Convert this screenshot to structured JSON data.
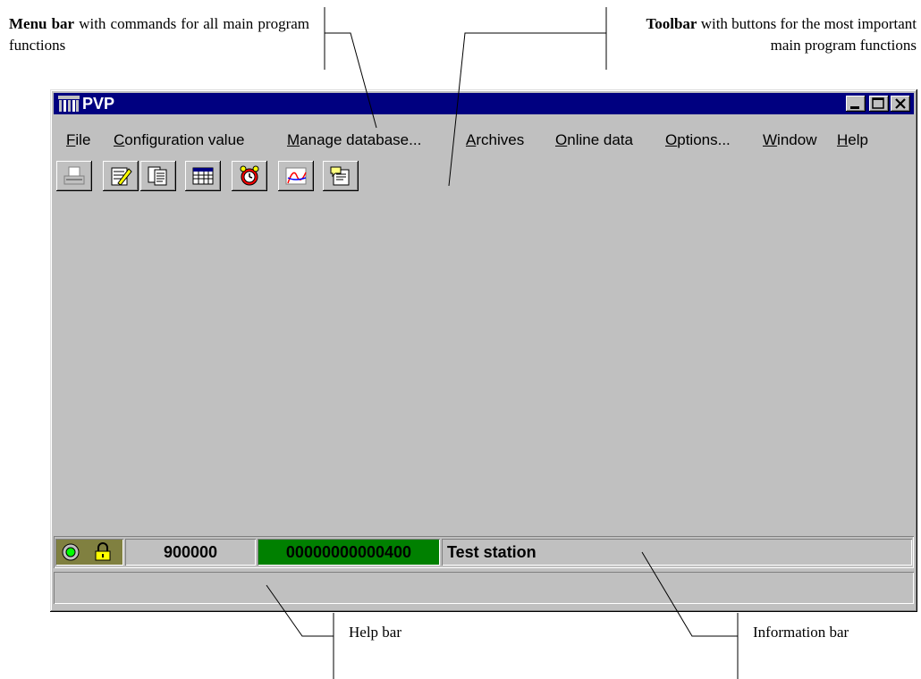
{
  "callouts": {
    "menu_bold": "Menu bar",
    "menu_rest": " with commands for all main program functions",
    "toolbar_bold": "Toolbar",
    "toolbar_rest": " with buttons for the most important main program functions",
    "help": "Help bar",
    "info": "Information bar"
  },
  "window": {
    "title": "PVP",
    "menu": [
      {
        "underline": "F",
        "rest": "ile"
      },
      {
        "underline": "C",
        "rest": "onfiguration value"
      },
      {
        "underline": "M",
        "rest": "anage database..."
      },
      {
        "underline": "A",
        "rest": "rchives"
      },
      {
        "underline": "O",
        "rest": "nline data"
      },
      {
        "underline": "O",
        "rest": "ptions..."
      },
      {
        "underline": "W",
        "rest": "indow"
      },
      {
        "underline": "H",
        "rest": "elp"
      }
    ],
    "toolbar_icons": [
      "print-icon",
      "edit-config-icon",
      "copy-pages-icon",
      "table-icon",
      "alarm-clock-icon",
      "chart-icon",
      "help-bubble-icon"
    ],
    "infobar": {
      "number": "900000",
      "code": "00000000000400",
      "station": "Test station"
    },
    "colors": {
      "titlebar": "#000080",
      "window": "#c0c0c0",
      "code_bg": "#008000",
      "status_bg": "#808040"
    }
  }
}
